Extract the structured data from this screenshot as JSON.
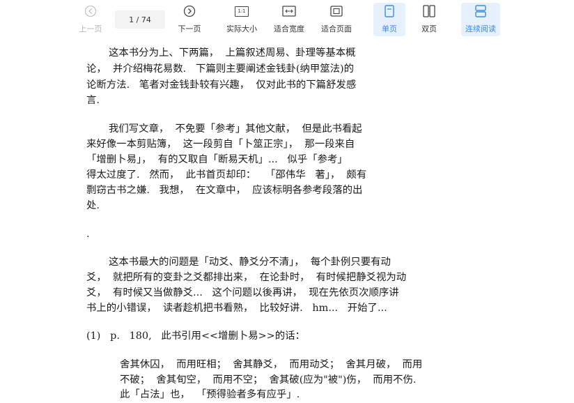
{
  "toolbar": {
    "prev": "上一页",
    "page_current": "1",
    "page_sep": " / ",
    "page_total": "74",
    "next": "下一页",
    "actual_size": "实际大小",
    "actual_size_glyph": "1:1",
    "fit_width": "适合宽度",
    "fit_page": "适合页面",
    "single_page": "单页",
    "double_page": "双页",
    "continuous": "连续阅读",
    "accent_color": "#3b8be8",
    "active_bg": "#e6f1fd",
    "icons": [
      "chevron-left-icon",
      "chevron-right-icon",
      "actual-size-icon",
      "fit-width-icon",
      "fit-page-icon",
      "single-page-icon",
      "double-page-icon",
      "continuous-icon"
    ]
  },
  "document": {
    "lines": [
      "这本书分为上、下两篇，  上篇叙述周易、卦理等基本概",
      "论，  并介绍梅花易数.   下篇则主要阐述金钱卦(纳甲筮法)的",
      "论断方法.   笔者对金钱卦较有兴趣，  仅对此书的下篇舒发感",
      "言.",
      "我们写文章，  不免要「参考」其他文献，  但是此书看起",
      "来好像一本剪贴簿，  这一段剪自「卜筮正宗」，  那一段来自",
      "「增删卜易」，  有的又取自「断易天机」...   似乎「参考」",
      "得太过度了.   然而，  此书首页却印：   「邵伟华   著」，  颇有",
      "剽窃古书之嫌.   我想，  在文章中，  应该标明各参考段落的出",
      "处.",
      ".",
      "这本书最大的问题是「动爻、静爻分不清」，  每个卦例只要有动",
      "爻，  就把所有的变卦之爻都排出来，  在论卦时，  有时候把静爻视为动",
      "爻，  有时候又当做静爻...   这个问题以後再讲，  现在先依页次顺序讲",
      "书上的小错误，  读者趁机把书看熟，  比较好讲.   hm...   开始了...",
      "(1)   p.   180,   此书引用<<增删卜易>>的话：",
      "舍其休囚，  而用旺相；  舍其静爻，  而用动爻；  舍其月破，  而用",
      "不破；  舍其旬空，  而用不空；  舍其破(应为\"被\")伤，  而用不伤.",
      "此「占法」也，  「预得验者多有应乎」."
    ]
  }
}
